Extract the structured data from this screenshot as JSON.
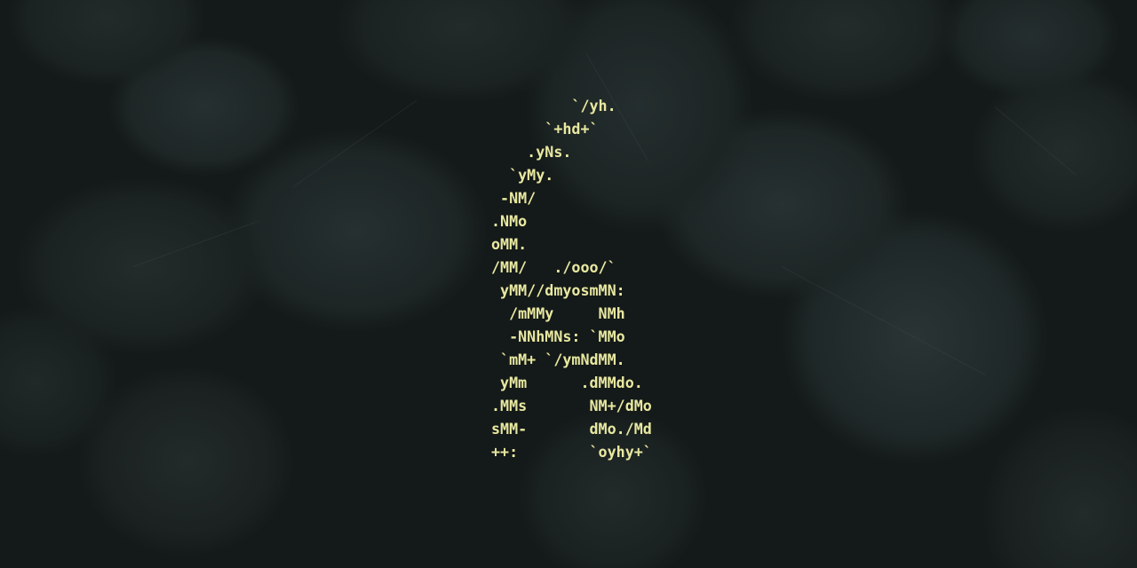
{
  "wallpaper": {
    "icon": "leaf-pattern",
    "base_color": "#14191a"
  },
  "ascii_logo": {
    "color": "#e8e8a0",
    "lines": [
      "         `/yh.",
      "      `+hd+`",
      "    .yNs.",
      "  `yMy.",
      " -NM/",
      ".NMo",
      "oMM.",
      "/MM/   ./ooo/`",
      " yMM//dmyosmMN:",
      "  /mMMy     NMh",
      "  -NNhMNs: `MMo",
      " `mM+ `/ymNdMM.",
      " yMm      .dMMdo.",
      ".MMs       NM+/dMo",
      "sMM-       dMo./Md",
      "++:        `oyhy+`"
    ]
  }
}
